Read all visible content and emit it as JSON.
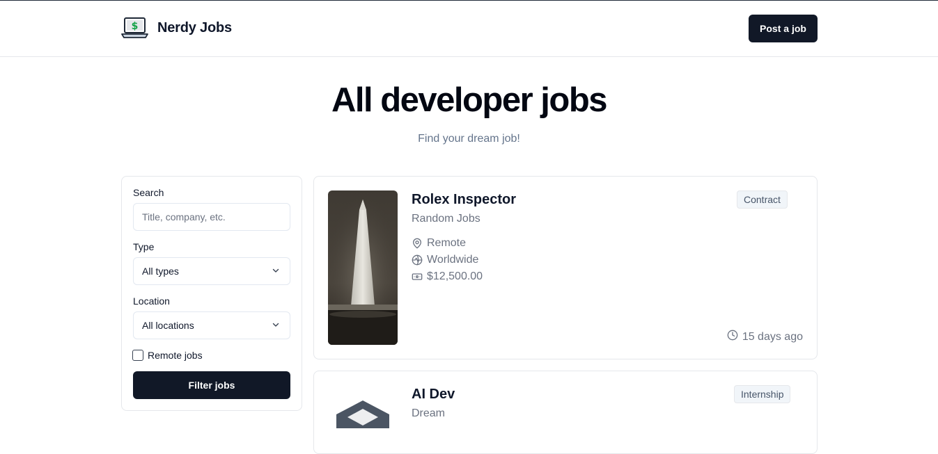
{
  "header": {
    "brand_name": "Nerdy Jobs",
    "post_job_label": "Post a job"
  },
  "hero": {
    "title": "All developer jobs",
    "subtitle": "Find your dream job!"
  },
  "filters": {
    "search_label": "Search",
    "search_placeholder": "Title, company, etc.",
    "search_value": "",
    "type_label": "Type",
    "type_value": "All types",
    "location_label": "Location",
    "location_value": "All locations",
    "remote_label": "Remote jobs",
    "remote_checked": false,
    "submit_label": "Filter jobs"
  },
  "jobs": [
    {
      "title": "Rolex Inspector",
      "company": "Random Jobs",
      "type": "Contract",
      "location_type": "Remote",
      "location": "Worldwide",
      "salary": "$12,500.00",
      "posted": "15 days ago"
    },
    {
      "title": "AI Dev",
      "company": "Dream",
      "type": "Internship"
    }
  ],
  "colors": {
    "primary_button": "#111827",
    "muted_text": "#6b7280",
    "badge_bg": "#f1f5f9",
    "border": "#e5e7eb"
  },
  "icons": {
    "logo": "laptop-dollar-icon",
    "location": "map-pin-icon",
    "globe": "globe-icon",
    "salary": "banknote-icon",
    "time": "clock-icon",
    "select": "chevron-down-icon"
  }
}
